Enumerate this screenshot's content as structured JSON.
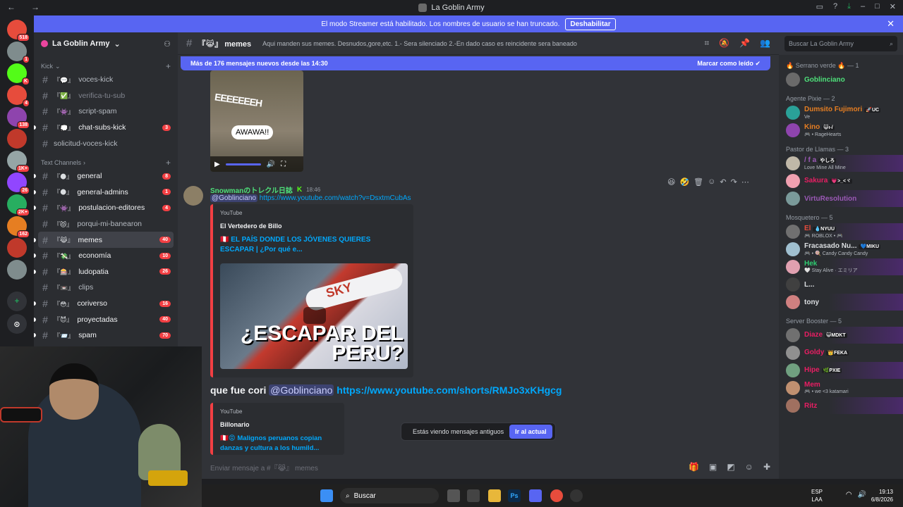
{
  "window": {
    "title": "La Goblin Army"
  },
  "banner": {
    "text": "El modo Streamer está habilitado. Los nombres de usuario se han truncado.",
    "button": "Deshabilitar"
  },
  "guilds": [
    {
      "label": "518",
      "color": "#e74c3c"
    },
    {
      "label": "1",
      "color": "#7f8c8d"
    },
    {
      "label": "K",
      "color": "#53fc18"
    },
    {
      "label": "4",
      "color": "#e74c3c"
    },
    {
      "label": "138",
      "color": "#8e44ad"
    },
    {
      "label": "",
      "color": "#c0392b"
    },
    {
      "label": "1K+",
      "color": "#95a5a6"
    },
    {
      "label": "26",
      "color": "#9146ff"
    },
    {
      "label": "2K+",
      "color": "#27ae60"
    },
    {
      "label": "162",
      "color": "#e67e22"
    },
    {
      "label": "",
      "color": "#c0392b"
    },
    {
      "label": "",
      "color": "#7f8c8d"
    }
  ],
  "server": {
    "name": "La Goblin Army"
  },
  "categories": {
    "kick": "Kick",
    "text": "Text Channels"
  },
  "kick_channels": [
    {
      "name": "voces-kick",
      "emoji": "『💬』",
      "count": ""
    },
    {
      "name": "verifica-tu-sub",
      "emoji": "『✅』",
      "count": ""
    },
    {
      "name": "script-spam",
      "emoji": "『👾』",
      "count": ""
    },
    {
      "name": "chat-subs-kick",
      "emoji": "『💭』",
      "count": "3"
    },
    {
      "name": "solicitud-voces-kick",
      "emoji": "",
      "count": ""
    }
  ],
  "text_channels": [
    {
      "name": "general",
      "emoji": "『🌑』",
      "count": "8"
    },
    {
      "name": "general-admins",
      "emoji": "『🌑』",
      "count": "1"
    },
    {
      "name": "postulacion-editores",
      "emoji": "『👾』",
      "count": "4"
    },
    {
      "name": "porqui-mi-banearon",
      "emoji": "『😾』",
      "count": ""
    },
    {
      "name": "memes",
      "emoji": "『😹』",
      "count": "40"
    },
    {
      "name": "economía",
      "emoji": "『💸』",
      "count": "10"
    },
    {
      "name": "ludopatia",
      "emoji": "『🎰』",
      "count": "26"
    },
    {
      "name": "clips",
      "emoji": "『📼』",
      "count": ""
    },
    {
      "name": "coriverso",
      "emoji": "『😳』",
      "count": "16"
    },
    {
      "name": "proyectadas",
      "emoji": "『😈』",
      "count": "40"
    },
    {
      "name": "spam",
      "emoji": "『📨』",
      "count": "70"
    }
  ],
  "topbar": {
    "channel": "『😹』 memes",
    "topic": "Aqui manden sus memes. Desnudos,gore,etc. 1.- Sera silenciado 2.-En dado caso es reincidente sera baneado"
  },
  "search": {
    "placeholder": "Buscar La Goblin Army"
  },
  "newbar": {
    "text": "Más de 176 mensajes nuevos desde las 14:30",
    "action": "Marcar como leído"
  },
  "video": {
    "caption_top": "EEEEEEEH",
    "caption_bubble": "AWAWA!!"
  },
  "message": {
    "username": "Snowmanのトレクル日誌",
    "time": "18:46",
    "mention": "@Goblinciano",
    "link": "https://www.youtube.com/watch?v=DsxtmCubAs"
  },
  "embed1": {
    "provider": "YouTube",
    "author": "El Vertedero de Billo",
    "title": "🇵🇪 EL PAÍS DONDE LOS JÓVENES QUIERES ESCAPAR | ¿Por qué e...",
    "thumb_text": "¿ESCAPAR DEL PERU?",
    "thumb_brand": "SKY"
  },
  "message2": {
    "text": "que fue cori",
    "mention": "@Goblinciano",
    "link": "https://www.youtube.com/shorts/RMJo3xKHgcg"
  },
  "embed2": {
    "provider": "YouTube",
    "author": "Billonario",
    "title": "🇵🇪😡 Malignos peruanos copian danzas y cultura a los humild..."
  },
  "old_messages": {
    "text": "Estás viendo mensajes antiguos",
    "button": "Ir al actual"
  },
  "composer": {
    "placeholder": "Enviar mensaje a #『😹』 memes"
  },
  "members": [
    {
      "category": "🔥 Serrano verde 🔥 — 1",
      "items": [
        {
          "name": "Goblinciano",
          "status": "",
          "tag": "",
          "color": "#4ee07a",
          "avatar": "#6a6a6a"
        }
      ]
    },
    {
      "category": "Agente Pixie — 2",
      "items": [
        {
          "name": "Dumsito Fujimori",
          "status": "Ve",
          "tag": "🚀UC",
          "color": "#e67e22",
          "avatar": "#2aa198"
        },
        {
          "name": "Kino",
          "status": "🎮 • RageHearts",
          "tag": "😺ı-/",
          "color": "#e67e22",
          "avatar": "#8e44ad"
        }
      ]
    },
    {
      "category": "Pastor de Llamas — 3",
      "items": [
        {
          "name": "/ f a",
          "status": "Love Mine All Mine",
          "tag": "やしろ",
          "color": "#9b59b6",
          "avatar": "#c0b8a8"
        },
        {
          "name": "Sakura",
          "status": "",
          "tag": "💗>_<ヾ",
          "color": "#e91e63",
          "avatar": "#f0a0b0"
        },
        {
          "name": "VirtuResolution",
          "status": "",
          "tag": "",
          "color": "#9b59b6",
          "avatar": "#7a9a9a"
        }
      ]
    },
    {
      "category": "Mosquetero — 5",
      "items": [
        {
          "name": "El",
          "status": "🎮 ROBLOX • 🎮",
          "tag": "💧NYUU",
          "color": "#e74c3c",
          "avatar": "#707070"
        },
        {
          "name": "Fracasado Nu...",
          "status": "🎮 • 🍭 Candy Candy Candy",
          "tag": "💙MIKU",
          "color": "#dbdee1",
          "avatar": "#a0c0d0"
        },
        {
          "name": "Hek",
          "status": "🤍 Stay Alive · エミリア",
          "tag": "",
          "color": "#2ecc71",
          "avatar": "#e0a0b0"
        },
        {
          "name": "L...",
          "status": "",
          "tag": "",
          "color": "#dbdee1",
          "avatar": "#404040"
        },
        {
          "name": "tony",
          "status": "",
          "tag": "",
          "color": "#dbdee1",
          "avatar": "#d08080"
        }
      ]
    },
    {
      "category": "Server Booster — 5",
      "items": [
        {
          "name": "Diaze",
          "status": "",
          "tag": "😺MDKT",
          "color": "#e91e63",
          "avatar": "#707070"
        },
        {
          "name": "Goldy",
          "status": "",
          "tag": "👑FEKA",
          "color": "#e91e63",
          "avatar": "#909090"
        },
        {
          "name": "Hipe",
          "status": "",
          "tag": "🌿PXIE",
          "color": "#e91e63",
          "avatar": "#70a080"
        },
        {
          "name": "Mem",
          "status": "🎮 • we <3 katamari",
          "tag": "",
          "color": "#e91e63",
          "avatar": "#c09070"
        },
        {
          "name": "Ritz",
          "status": "",
          "tag": "",
          "color": "#e91e63",
          "avatar": "#a07060"
        }
      ]
    }
  ],
  "taskbar": {
    "search": "Buscar",
    "lang1": "ESP",
    "lang2": "LAA",
    "time": "19:13",
    "date": "6/8/2026"
  }
}
